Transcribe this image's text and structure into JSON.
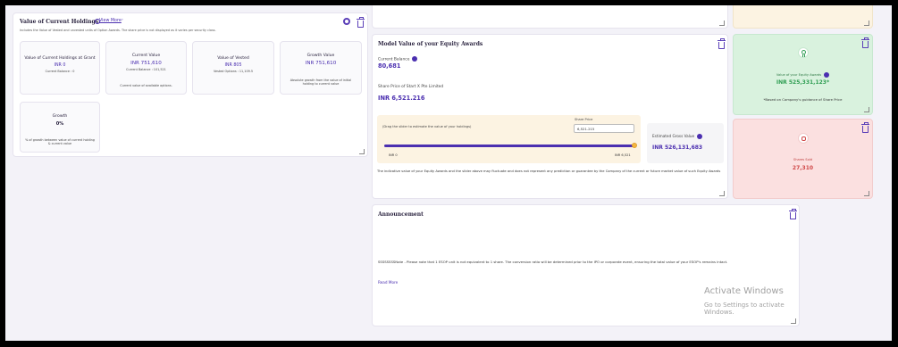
{
  "holdings": {
    "title": "Value of Current Holdings",
    "view_more": "View More",
    "description": "Includes the Value of Vested and unvested units of Option Awards. The share price is not displayed as it varies per security class.",
    "cards": [
      {
        "title": "Value of Current Holdings at Grant",
        "value": "INR 0",
        "sub": "Current Balance : 0",
        "note": ""
      },
      {
        "title": "Current Value",
        "value": "INR 751,610",
        "sub": "Current Balance : 101,521",
        "note": "Current value of available options."
      },
      {
        "title": "Value of Vested",
        "value": "INR 805",
        "sub": "Vested Options : 11,109.5",
        "note": ""
      },
      {
        "title": "Growth Value",
        "value": "INR 751,610",
        "sub": "",
        "note": "Absolute growth from the value of initial holding to current value"
      },
      {
        "title": "Growth",
        "value": "0%",
        "sub": "",
        "note": "% of growth between value of current holding & current value"
      }
    ]
  },
  "model": {
    "title": "Model Value of your Equity Awards",
    "current_balance_label": "Current Balance",
    "current_balance_value": "80,681",
    "share_price_label": "Share Price of Start X Pte Limited",
    "share_price_value": "INR 6,521.216",
    "slider_hint": "(Drag the slider to estimate the value of your holdings)",
    "share_price_input_label": "Share Price",
    "share_price_input_value": "6,521.215",
    "slider_fraction": 1.0,
    "slider_min_label": "INR 0",
    "slider_max_label": "INR 6,521",
    "gross_label": "Estimated Gross Value",
    "gross_value": "INR 526,131,683",
    "disclaimer": "The indicative value of your Equity Awards and the slider above may fluctuate and does not represent any prediction or guarantee by the Company of the current or future market value of such Equity Awards"
  },
  "equity_value": {
    "label": "Value of your Equity Awards",
    "value": "INR 525,331,123*",
    "footnote": "*Based on Company's guidance of Share Price"
  },
  "shares_sold": {
    "label": "Shares Sold",
    "value": "27,310"
  },
  "announcement": {
    "title": "Announcement",
    "text": "SSSSSSSSNote - Please note that 1 ESOP unit is not equivalent to 1 share. The conversion ratio will be determined prior to the IPO or corporate event, ensuring the total value of your ESOP's remains intact.",
    "read_more": "Read More"
  },
  "watermark": {
    "line1": "Activate Windows",
    "line2": "Go to Settings to activate Windows."
  },
  "colors": {
    "accent": "#4b2fb0",
    "green_bg": "#d9f2de",
    "red_bg": "#fbe0e0",
    "yellow_bg": "#fcf3e2"
  }
}
